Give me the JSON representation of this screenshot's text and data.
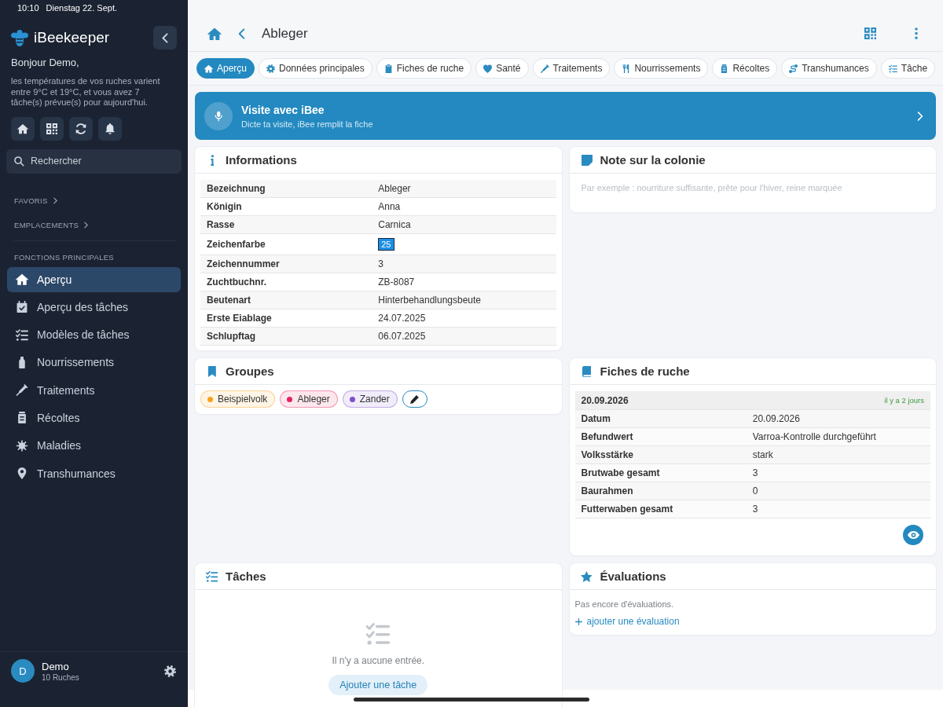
{
  "status_bar": {
    "time": "10:10",
    "date": "Dienstag 22. Sept."
  },
  "sidebar": {
    "app_name": "iBeekeeper",
    "greeting": "Bonjour Demo,",
    "message": "les températures de vos ruches varient entre 9°C et 19°C, et vous avez 7 tâche(s) prévue(s) pour aujourd'hui.",
    "search": {
      "placeholder": "Rechercher"
    },
    "sections": [
      {
        "label": "FAVORIS",
        "expanded": false
      },
      {
        "label": "EMPLACEMENTS",
        "expanded": false
      }
    ],
    "section_title": "FONCTIONS PRINCIPALES",
    "nav_items": [
      {
        "label": "Aperçu",
        "selected": true
      },
      {
        "label": "Aperçu des tâches",
        "selected": false
      },
      {
        "label": "Modèles de tâches",
        "selected": false
      },
      {
        "label": "Nourrissements",
        "selected": false
      },
      {
        "label": "Traitements",
        "selected": false
      },
      {
        "label": "Récoltes",
        "selected": false
      },
      {
        "label": "Maladies",
        "selected": false
      },
      {
        "label": "Transhumances",
        "selected": false
      }
    ],
    "user": {
      "initial": "D",
      "name": "Demo",
      "subtitle": "10 Ruches"
    }
  },
  "header": {
    "title": "Ableger"
  },
  "tabs": [
    {
      "label": "Aperçu",
      "selected": true
    },
    {
      "label": "Données principales",
      "selected": false
    },
    {
      "label": "Fiches de ruche",
      "selected": false
    },
    {
      "label": "Santé",
      "selected": false
    },
    {
      "label": "Traitements",
      "selected": false
    },
    {
      "label": "Nourrissements",
      "selected": false
    },
    {
      "label": "Récoltes",
      "selected": false
    },
    {
      "label": "Transhumances",
      "selected": false
    },
    {
      "label": "Tâche",
      "selected": false
    }
  ],
  "ibee_banner": {
    "title": "Visite avec iBee",
    "subtitle": "Dicte ta visite, iBee remplit la fiche"
  },
  "informations": {
    "title": "Informations",
    "rows": [
      {
        "label": "Bezeichnung",
        "value": "Ableger"
      },
      {
        "label": "Königin",
        "value": "Anna"
      },
      {
        "label": "Rasse",
        "value": "Carnica"
      },
      {
        "label": "Zeichenfarbe",
        "value": "25",
        "color": "#1e8fe6"
      },
      {
        "label": "Zeichennummer",
        "value": "3"
      },
      {
        "label": "Zuchtbuchnr.",
        "value": "ZB-8087"
      },
      {
        "label": "Beutenart",
        "value": "Hinterbehandlungsbeute"
      },
      {
        "label": "Erste Eiablage",
        "value": "24.07.2025"
      },
      {
        "label": "Schlupftag",
        "value": "06.07.2025"
      }
    ]
  },
  "note": {
    "title": "Note sur la colonie",
    "placeholder": "Par exemple : nourriture suffisante, prête pour l'hiver, reine marquée"
  },
  "groups": {
    "title": "Groupes",
    "items": [
      {
        "label": "Beispielvolk",
        "color": "#f7a21b"
      },
      {
        "label": "Ableger",
        "color": "#e5245f"
      },
      {
        "label": "Zander",
        "color": "#7b4fc9"
      }
    ]
  },
  "hive_records": {
    "title": "Fiches de ruche",
    "date": "20.09.2026",
    "age": "il y a 2 jours",
    "rows": [
      {
        "label": "Datum",
        "value": "20.09.2026"
      },
      {
        "label": "Befundwert",
        "value": "Varroa-Kontrolle durchgeführt"
      },
      {
        "label": "Volksstärke",
        "value": "stark"
      },
      {
        "label": "Brutwabe gesamt",
        "value": "3"
      },
      {
        "label": "Baurahmen",
        "value": "0"
      },
      {
        "label": "Futterwaben gesamt",
        "value": "3"
      }
    ]
  },
  "tasks": {
    "title": "Tâches",
    "empty_text": "Il n'y a aucune entrée.",
    "add_button": "Ajouter une tâche"
  },
  "ratings": {
    "title": "Évaluations",
    "empty_text": "Pas encore d'évaluations.",
    "add_link": "ajouter une évaluation"
  }
}
